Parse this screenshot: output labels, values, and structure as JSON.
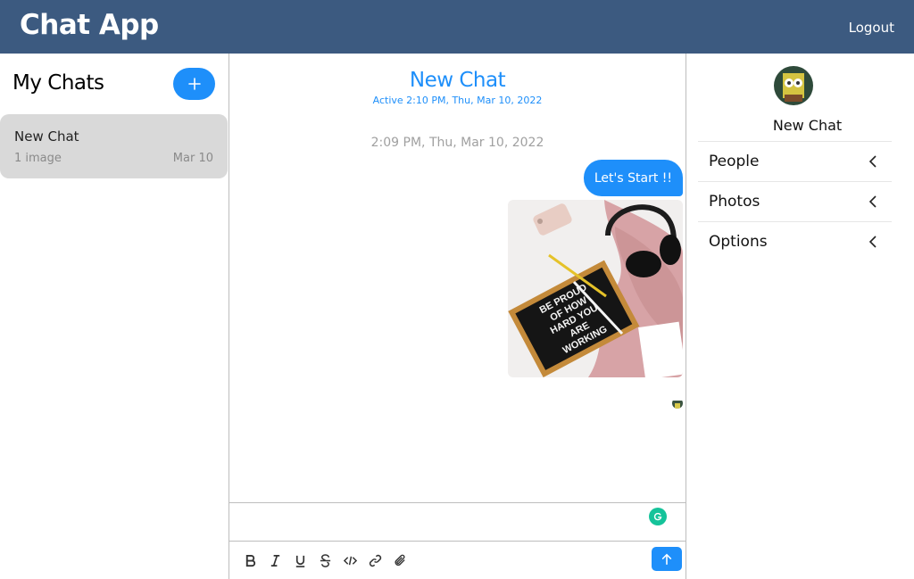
{
  "app": {
    "title": "Chat App",
    "logout_label": "Logout"
  },
  "sidebar": {
    "title": "My Chats",
    "new_chat_icon": "plus-icon",
    "chats": [
      {
        "name": "New Chat",
        "preview": "1 image",
        "date": "Mar 10"
      }
    ]
  },
  "chat": {
    "title": "New Chat",
    "active": "Active 2:10 PM, Thu, Mar 10, 2022",
    "messages_timestamp": "2:09 PM, Thu, Mar 10, 2022",
    "message_text": "Let's Start !!",
    "image_lettering": [
      "BE PROUD",
      "OF HOW",
      "HARD YOU",
      "ARE",
      "WORKING"
    ]
  },
  "composer": {
    "placeholder": "",
    "tools": [
      "bold-icon",
      "italic-icon",
      "underline-icon",
      "strikethrough-icon",
      "code-icon",
      "link-icon",
      "attach-icon"
    ],
    "send_icon": "arrow-up-icon"
  },
  "details": {
    "name": "New Chat",
    "sections": [
      {
        "label": "People"
      },
      {
        "label": "Photos"
      },
      {
        "label": "Options"
      }
    ]
  },
  "colors": {
    "header": "#3c5a80",
    "accent": "#1e8ffa",
    "selected_chat": "#d9d9d9",
    "grammarly": "#15c39a"
  }
}
